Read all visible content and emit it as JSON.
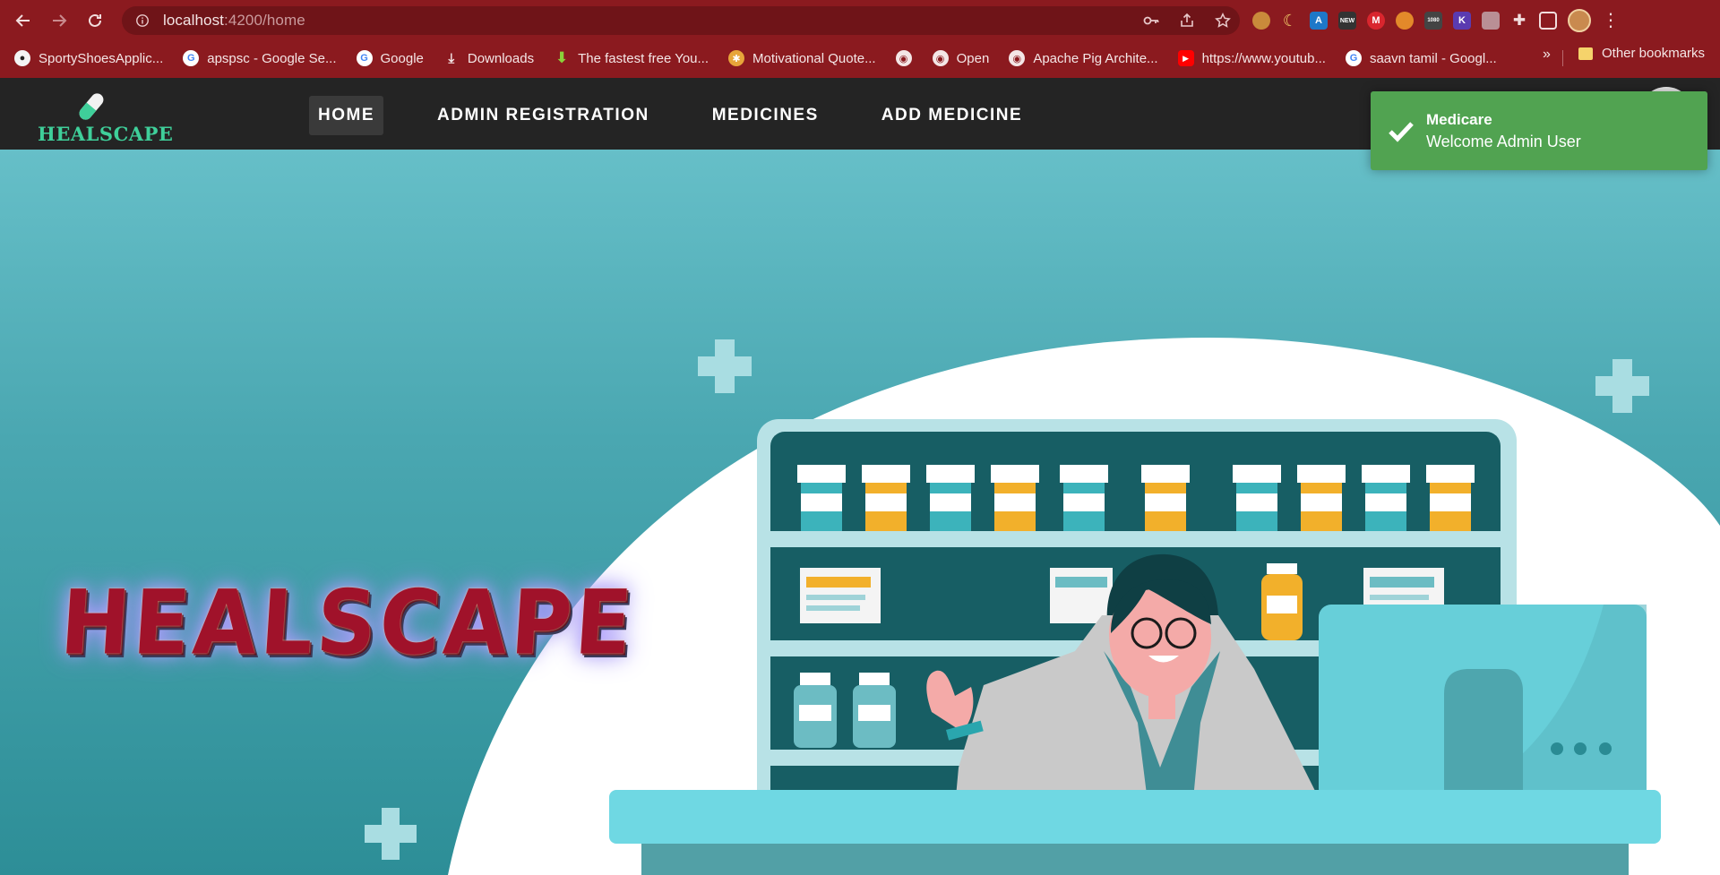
{
  "browser": {
    "url_host": "localhost",
    "url_rest": ":4200/home",
    "bookmarks": [
      {
        "label": "SportyShoesApplic...",
        "icon": "github-icon"
      },
      {
        "label": "apspsc - Google Se...",
        "icon": "google-icon"
      },
      {
        "label": "Google",
        "icon": "google-icon"
      },
      {
        "label": "Downloads",
        "icon": "download-icon"
      },
      {
        "label": "The fastest free You...",
        "icon": "arrow-down-icon"
      },
      {
        "label": "Motivational Quote...",
        "icon": "pinwheel-icon"
      },
      {
        "label": "",
        "icon": "globe-icon"
      },
      {
        "label": "Open",
        "icon": "globe-icon"
      },
      {
        "label": "Apache Pig Archite...",
        "icon": "globe-icon"
      },
      {
        "label": "https://www.youtub...",
        "icon": "youtube-icon"
      },
      {
        "label": "saavn tamil - Googl...",
        "icon": "google-icon"
      }
    ],
    "more_label": "»",
    "other_bookmarks": "Other bookmarks"
  },
  "app": {
    "brand": "HEALSCAPE",
    "nav": [
      {
        "label": "HOME",
        "active": true
      },
      {
        "label": "ADMIN REGISTRATION",
        "active": false
      },
      {
        "label": "MEDICINES",
        "active": false
      },
      {
        "label": "ADD MEDICINE",
        "active": false
      }
    ],
    "hero_title": "HEALSCAPE"
  },
  "toast": {
    "title": "Medicare",
    "message": "Welcome Admin User",
    "color": "#51a351"
  },
  "colors": {
    "chrome": "#8b1a1f",
    "navbar": "#242424",
    "hero_top": "#66bfc8",
    "hero_bottom": "#2d8e97",
    "shelf_dark": "#175e64"
  }
}
